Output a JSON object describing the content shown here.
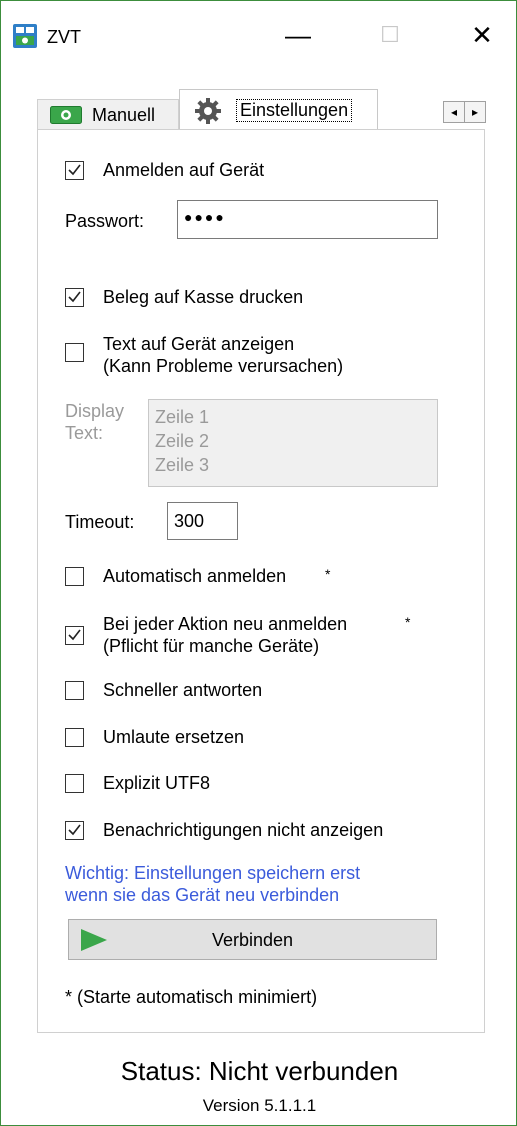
{
  "window": {
    "title": "ZVT",
    "minimize_glyph": "—",
    "maximize_glyph": "☐",
    "close_glyph": "✕"
  },
  "tabs": [
    {
      "label": "Manuell",
      "icon": "money-icon",
      "selected": false
    },
    {
      "label": "Einstellungen",
      "icon": "gear-icon",
      "selected": true
    }
  ],
  "tab_scroll": {
    "left": "◂",
    "right": "▸"
  },
  "settings": {
    "anmelden": {
      "label": "Anmelden auf Gerät",
      "checked": true
    },
    "passwort": {
      "label": "Passwort:",
      "value": "●●●●"
    },
    "beleg": {
      "label": "Beleg auf Kasse drucken",
      "checked": true
    },
    "text_anzeigen": {
      "label_line1": "Text auf Gerät anzeigen",
      "label_line2": "(Kann Probleme verursachen)",
      "checked": false
    },
    "display_text": {
      "label_line1": "Display",
      "label_line2": "Text:",
      "lines": [
        "Zeile 1",
        "Zeile 2",
        "Zeile 3"
      ]
    },
    "timeout": {
      "label": "Timeout:",
      "value": "300"
    },
    "auto_anmelden": {
      "label": "Automatisch anmelden",
      "asterisk": "*",
      "checked": false
    },
    "neu_anmelden": {
      "label_line1": "Bei jeder Aktion neu anmelden",
      "asterisk": "*",
      "label_line2": "(Pflicht für manche Geräte)",
      "checked": true
    },
    "schneller": {
      "label": "Schneller antworten",
      "checked": false
    },
    "umlaute": {
      "label": "Umlaute ersetzen",
      "checked": false
    },
    "utf8": {
      "label": "Explizit UTF8",
      "checked": false
    },
    "benachrichtigungen": {
      "label": "Benachrichtigungen nicht anzeigen",
      "checked": true
    },
    "hinweis_line1": "Wichtig: Einstellungen speichern erst",
    "hinweis_line2": "wenn sie das Gerät neu verbinden",
    "verbinden_label": "Verbinden",
    "footnote": "* (Starte automatisch minimiert)"
  },
  "status": {
    "text": "Status: Nicht verbunden",
    "version": "Version 5.1.1.1"
  },
  "colors": {
    "accent_green": "#3c8d3c",
    "hint_blue": "#3b5bdb",
    "play_green": "#3aa64a"
  }
}
